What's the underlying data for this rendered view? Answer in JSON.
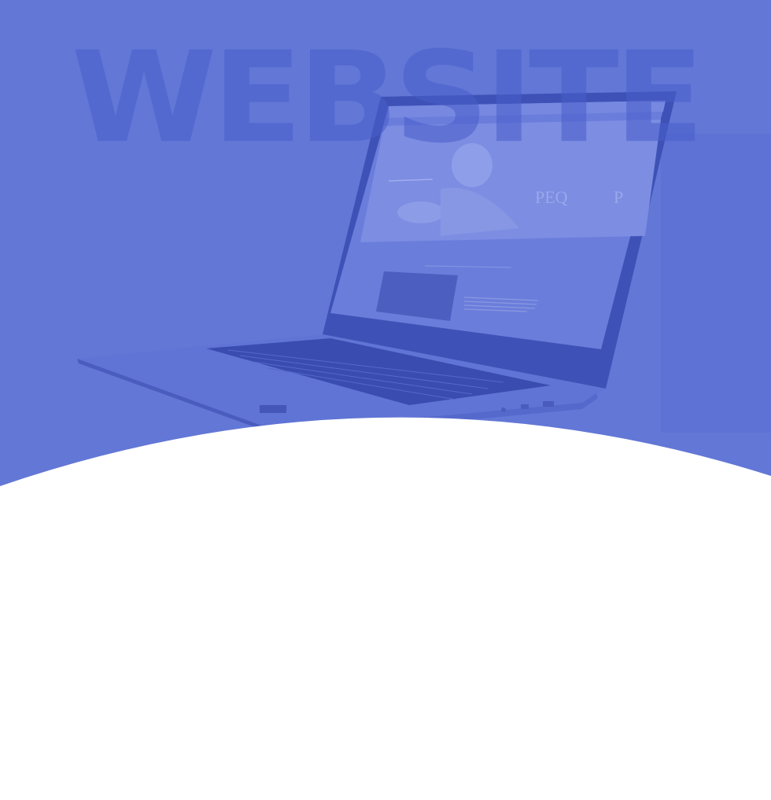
{
  "hero": {
    "background_color": "#6277d6",
    "bottom_color": "#ffffff",
    "watermark_text": "WEBSITE",
    "laptop_icon": "laptop-icon",
    "screen_banner_text": "PEQ",
    "screen_banner_text2": "P"
  }
}
